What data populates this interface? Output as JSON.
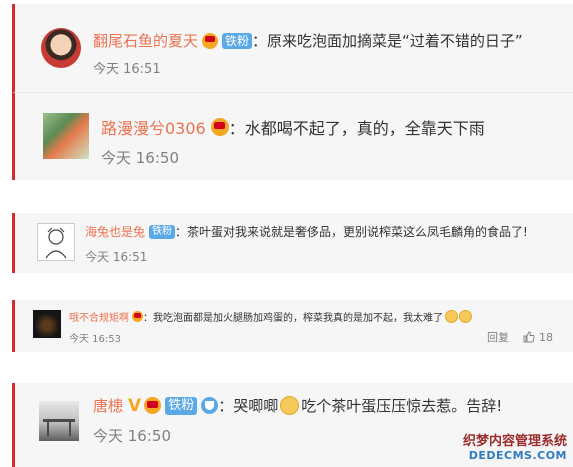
{
  "comments": [
    {
      "username": "翻尾石鱼的夏天",
      "fan_badge": "铁粉",
      "separator": "：",
      "text": "原来吃泡面加摘菜是“过着不错的日子”",
      "time": "今天 16:51"
    },
    {
      "username": "路漫漫兮0306",
      "separator": "：",
      "text": "水都喝不起了，真的，全靠天下雨",
      "time": "今天 16:50"
    },
    {
      "username": "海兔也是兔",
      "fan_badge": "铁粉",
      "separator": "：",
      "text": "茶叶蛋对我来说就是奢侈品，更别说榨菜这么凤毛麟角的食品了!",
      "time": "今天 16:51"
    },
    {
      "username": "哦不合规矩啊",
      "separator": "：",
      "text": "我吃泡面都是加火腿肠加鸡蛋的，榨菜我真的是加不起，我太难了",
      "time": "今天 16:53",
      "reply_label": "回复",
      "like_count": "18"
    },
    {
      "username": "唐槵",
      "verified": "V",
      "fan_badge": "铁粉",
      "separator": "：",
      "text_before": "哭唧唧",
      "text_after": "吃个茶叶蛋压压惊去惹。告辞!",
      "time": "今天 16:50"
    }
  ],
  "watermark": {
    "line1": "织梦内容管理系统",
    "line2": "DEDECMS.COM"
  },
  "colors": {
    "accent_border": "#d52c2b",
    "username": "#eb7350",
    "fan_badge": "#5aa9e6",
    "card_bg": "#f6f6f6"
  }
}
